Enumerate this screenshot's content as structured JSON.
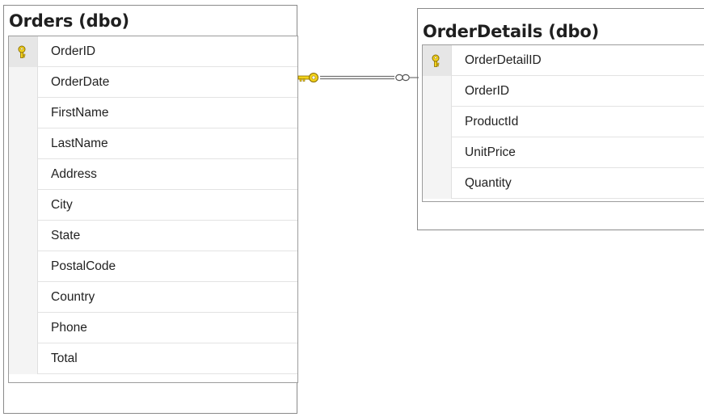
{
  "tables": [
    {
      "title": "Orders (dbo)",
      "columns": [
        {
          "name": "OrderID",
          "primary_key": true
        },
        {
          "name": "OrderDate",
          "primary_key": false
        },
        {
          "name": "FirstName",
          "primary_key": false
        },
        {
          "name": "LastName",
          "primary_key": false
        },
        {
          "name": "Address",
          "primary_key": false
        },
        {
          "name": "City",
          "primary_key": false
        },
        {
          "name": "State",
          "primary_key": false
        },
        {
          "name": "PostalCode",
          "primary_key": false
        },
        {
          "name": "Country",
          "primary_key": false
        },
        {
          "name": "Phone",
          "primary_key": false
        },
        {
          "name": "Total",
          "primary_key": false
        }
      ]
    },
    {
      "title": "OrderDetails (dbo)",
      "columns": [
        {
          "name": "OrderDetailID",
          "primary_key": true
        },
        {
          "name": "OrderID",
          "primary_key": false
        },
        {
          "name": "ProductId",
          "primary_key": false
        },
        {
          "name": "UnitPrice",
          "primary_key": false
        },
        {
          "name": "Quantity",
          "primary_key": false
        }
      ]
    }
  ],
  "relationship": {
    "from_table": "Orders (dbo)",
    "to_table": "OrderDetails (dbo)",
    "one_end": "key-icon",
    "many_end": "infinity-icon"
  },
  "colors": {
    "key_fill": "#f2d21b",
    "key_stroke": "#8a6d00",
    "border": "#8a8a8a",
    "line": "#707070"
  }
}
